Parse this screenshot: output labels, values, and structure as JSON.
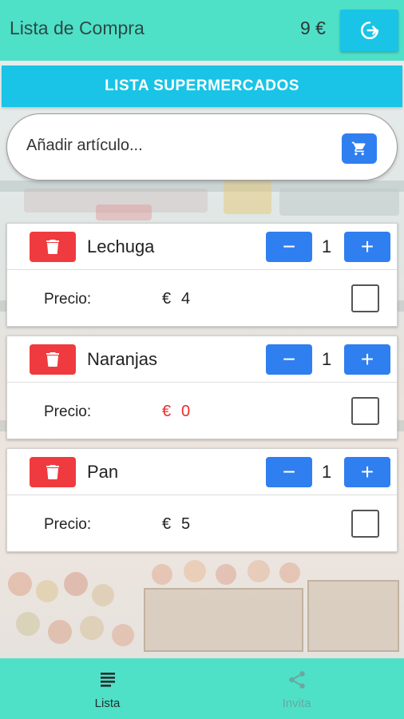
{
  "header": {
    "title": "Lista de Compra",
    "total": "9 €",
    "logout_icon": "logout-icon"
  },
  "list": {
    "name": "LISTA SUPERMERCADOS"
  },
  "add_item": {
    "placeholder": "Añadir artículo...",
    "value": "",
    "button_icon": "cart-icon"
  },
  "items": [
    {
      "name": "Lechuga",
      "quantity": "1",
      "price_label": "Precio:",
      "currency": "€",
      "price": "4",
      "price_color": "#222222",
      "checked": false
    },
    {
      "name": "Naranjas",
      "quantity": "1",
      "price_label": "Precio:",
      "currency": "€",
      "price": "0",
      "price_color": "#ee2b2b",
      "checked": false
    },
    {
      "name": "Pan",
      "quantity": "1",
      "price_label": "Precio:",
      "currency": "€",
      "price": "5",
      "price_color": "#222222",
      "checked": false
    }
  ],
  "controls": {
    "minus": "−",
    "plus": "+"
  },
  "nav": {
    "items": [
      {
        "label": "Lista",
        "icon": "list-icon",
        "active": true
      },
      {
        "label": "Invita",
        "icon": "share-icon",
        "active": false
      }
    ]
  },
  "colors": {
    "primary": "#4fe0c8",
    "accent": "#19c4e6",
    "button_blue": "#2f7ff0",
    "delete_red": "#ef3b3f",
    "warning_price": "#ee2b2b"
  }
}
